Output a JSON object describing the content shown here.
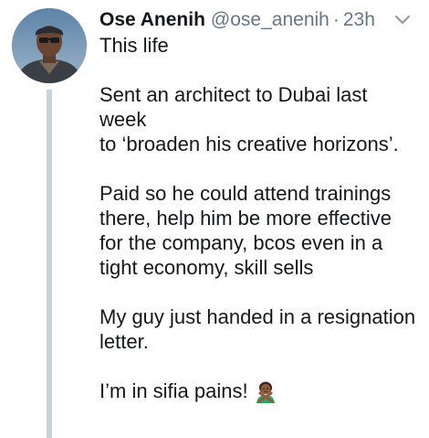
{
  "tweet": {
    "display_name": "Ose Anenih",
    "handle": "@ose_anenih",
    "separator": "·",
    "time": "23h",
    "paragraphs": [
      "This life",
      "Sent an architect to Dubai last week\nto ‘broaden his creative horizons’.",
      "Paid so he could attend trainings\nthere, help him be more effective\nfor the company, bcos even in a\ntight economy, skill sells",
      "My guy just handed in a resignation\nletter."
    ],
    "last_line": "I’m in sifia pains!",
    "emoji": "person-gesturing-no-emoji",
    "icons": {
      "caret": "chevron-down-icon"
    },
    "colors": {
      "text": "#14171a",
      "secondary": "#657786",
      "thread_line": "#c8d3db"
    }
  }
}
